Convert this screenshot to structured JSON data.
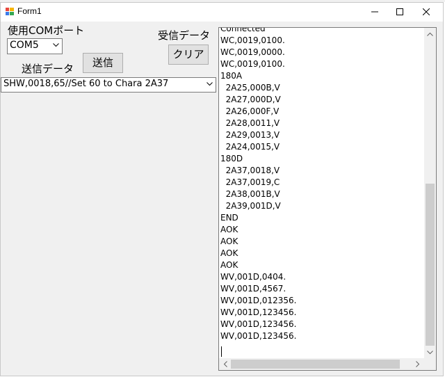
{
  "window": {
    "title": "Form1"
  },
  "labels": {
    "com_port": "使用COMポート",
    "receive_data": "受信データ",
    "send_data": "送信データ"
  },
  "com_port_select": {
    "value": "COM5"
  },
  "send_button": {
    "label": "送信"
  },
  "clear_button": {
    "label": "クリア"
  },
  "send_data_select": {
    "value": "SHW,0018,65//Set 60 to Chara 2A37"
  },
  "receive_log": {
    "lines": [
      "Connected",
      "WC,0019,0100.",
      "WC,0019,0000.",
      "WC,0019,0100.",
      "180A",
      "  2A25,000B,V",
      "  2A27,000D,V",
      "  2A26,000F,V",
      "  2A28,0011,V",
      "  2A29,0013,V",
      "  2A24,0015,V",
      "180D",
      "  2A37,0018,V",
      "  2A37,0019,C",
      "  2A38,001B,V",
      "  2A39,001D,V",
      "END",
      "AOK",
      "AOK",
      "AOK",
      "AOK",
      "WV,001D,0404.",
      "WV,001D,4567.",
      "WV,001D,012356.",
      "WV,001D,123456.",
      "WV,001D,123456.",
      "WV,001D,123456."
    ]
  },
  "colors": {
    "window_bg": "#f0f0f0",
    "scroll_thumb": "#cdcdcd",
    "button_face": "#e1e1e1"
  }
}
